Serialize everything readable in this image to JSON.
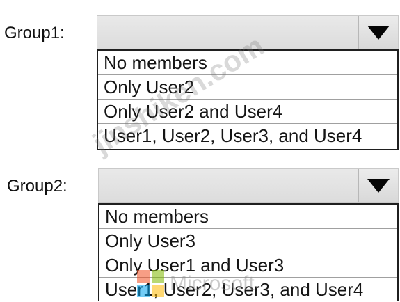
{
  "group1": {
    "label": "Group1:",
    "selected": "",
    "options": [
      "No members",
      "Only User2",
      "Only User2 and User4",
      "User1, User2, User3, and User4"
    ]
  },
  "group2": {
    "label": "Group2:",
    "selected": "",
    "options": [
      "No members",
      "Only User3",
      "Only User1 and User3",
      "User1, User2, User3, and User4"
    ]
  },
  "watermark": {
    "text": "jinshiken.com",
    "brand": "Microsoft"
  },
  "colors": {
    "ms_red": "#f25022",
    "ms_green": "#7fba00",
    "ms_blue": "#00a4ef",
    "ms_yellow": "#ffb900"
  },
  "icons": {
    "dropdown": "chevron-down-icon"
  }
}
